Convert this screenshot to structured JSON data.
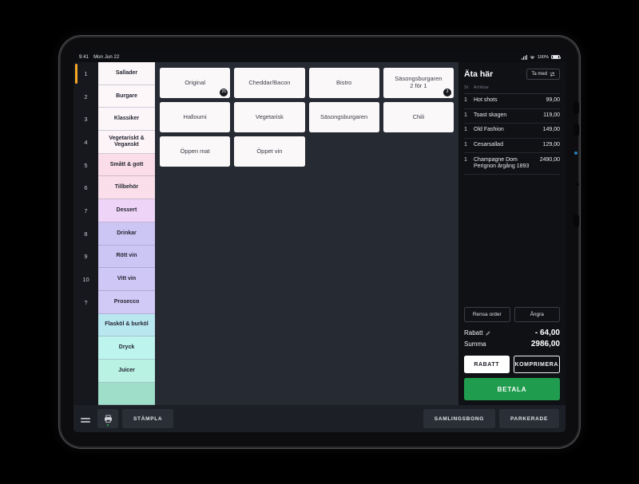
{
  "status_bar": {
    "time": "9:41",
    "date": "Mon Jun 22",
    "battery": "100%",
    "icons": [
      "cellular-signal-icon",
      "wifi-icon",
      "battery-icon"
    ]
  },
  "categories": [
    {
      "number": "1",
      "label": "Sallader",
      "color": "#fbf7f8"
    },
    {
      "number": "2",
      "label": "Burgare",
      "color": "#fdf7fa"
    },
    {
      "number": "3",
      "label": "Klassiker",
      "color": "#fcf6f9"
    },
    {
      "number": "4",
      "label": "Vegetariskt & Veganskt",
      "color": "#fdf4f8"
    },
    {
      "number": "5",
      "label": "Smått & gott",
      "color": "#fadde8"
    },
    {
      "number": "6",
      "label": "Tillbehör",
      "color": "#fadfea"
    },
    {
      "number": "7",
      "label": "Dessert",
      "color": "#eed4f7"
    },
    {
      "number": "8",
      "label": "Drinkar",
      "color": "#ccc6f5"
    },
    {
      "number": "9",
      "label": "Rött vin",
      "color": "#cbc6f4"
    },
    {
      "number": "10",
      "label": "Vitt vin",
      "color": "#cfc7f5"
    },
    {
      "number": "?",
      "label": "Prosecco",
      "color": "#d2caf6"
    },
    {
      "number": "",
      "label": "Flasköl & burköl",
      "color": "#b9e7f0"
    },
    {
      "number": "",
      "label": "Dryck",
      "color": "#bdf5ee"
    },
    {
      "number": "",
      "label": "Juicer",
      "color": "#b9f1e3"
    },
    {
      "number": "",
      "label": "",
      "color": "#9fdec9"
    }
  ],
  "selected_category_index": 1,
  "active_category_index": 0,
  "products": [
    {
      "label": "Original",
      "badge": "25"
    },
    {
      "label": "Cheddar/Bacon",
      "badge": ""
    },
    {
      "label": "Bistro",
      "badge": ""
    },
    {
      "label": "Säsongsburgaren\n2 för 1",
      "badge": "3"
    },
    {
      "label": "Halloumi",
      "badge": ""
    },
    {
      "label": "Vegetarisk",
      "badge": ""
    },
    {
      "label": "Säsongsburgaren",
      "badge": ""
    },
    {
      "label": "Chili",
      "badge": ""
    },
    {
      "label": "Öppen mat",
      "badge": ""
    },
    {
      "label": "Öppet vin",
      "badge": ""
    }
  ],
  "order": {
    "title": "Äta här",
    "takeaway_label": "Ta med",
    "takeaway_icon": "swap-arrows-icon",
    "col_qty": "St",
    "col_item": "Artiklar",
    "lines": [
      {
        "qty": "1",
        "name": "Hot shots",
        "price": "99,00"
      },
      {
        "qty": "1",
        "name": "Toast skagen",
        "price": "119,00"
      },
      {
        "qty": "1",
        "name": "Old Fashion",
        "price": "149,00"
      },
      {
        "qty": "1",
        "name": "Cesarsallad",
        "price": "129,00"
      },
      {
        "qty": "1",
        "name": "Champagne Dom Perignon årgång 1893",
        "price": "2490,00"
      }
    ],
    "clear_label": "Rensa order",
    "undo_label": "Ångra",
    "discount_label": "Rabatt",
    "discount_icon": "pencil-edit-icon",
    "discount_value": "- 64,00",
    "total_label": "Summa",
    "total_value": "2986,00",
    "rabatt_button": "RABATT",
    "komprimera_button": "KOMPRIMERA",
    "pay_button": "BETALA",
    "pay_color": "#1f9c4d"
  },
  "bottom_bar": {
    "menu_icon": "hamburger-menu-icon",
    "printer_icon": "printer-icon",
    "stamp_label": "STÄMPLA",
    "collect_label": "SAMLINGSBONG",
    "parked_label": "PARKERADE"
  }
}
